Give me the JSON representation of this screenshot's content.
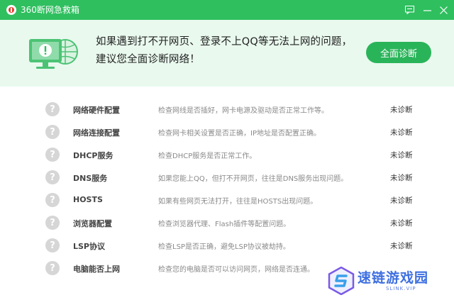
{
  "titlebar": {
    "title": "360断网急救箱",
    "icons": [
      "app-logo-icon",
      "feedback-icon",
      "minimize-icon",
      "close-icon"
    ]
  },
  "header": {
    "line1": "如果遇到打不开网页、登录不上QQ等无法上网的问题，",
    "line2": "建议您全面诊断网络！",
    "button_label": "全面诊断",
    "illustration": "computer-globe-warning-icon"
  },
  "items": [
    {
      "name": "网络硬件配置",
      "desc": "检查网线是否插好，网卡电源及驱动是否正常工作等。",
      "status": "未诊断"
    },
    {
      "name": "网络连接配置",
      "desc": "检查网卡相关设置是否正确，IP地址是否配置正确。",
      "status": "未诊断"
    },
    {
      "name": "DHCP服务",
      "desc": "检查DHCP服务是否正常工作。",
      "status": "未诊断"
    },
    {
      "name": "DNS服务",
      "desc": "如果您能上QQ，但打不开网页，往往是DNS服务出现问题。",
      "status": "未诊断"
    },
    {
      "name": "HOSTS",
      "desc": "如果有些网页无法打开，往往是HOSTS出现问题。",
      "status": "未诊断"
    },
    {
      "name": "浏览器配置",
      "desc": "检查浏览器代理、Flash插件等配置问题。",
      "status": "未诊断"
    },
    {
      "name": "LSP协议",
      "desc": "检查LSP是否正确，避免LSP协议被劫持。",
      "status": "未诊断"
    },
    {
      "name": "电脑能否上网",
      "desc": "检查您的电脑是否可以访问网页，网络是否连通。",
      "status": ""
    }
  ],
  "status_icon_glyph": "?",
  "watermark": {
    "text": "速链游戏园",
    "sub": "SLINK.VIP"
  },
  "colors": {
    "brand_green": "#2fbf5f",
    "button_green": "#2ab45a",
    "header_bg": "#e9f9ee",
    "pending_grey": "#d6d6d6"
  }
}
